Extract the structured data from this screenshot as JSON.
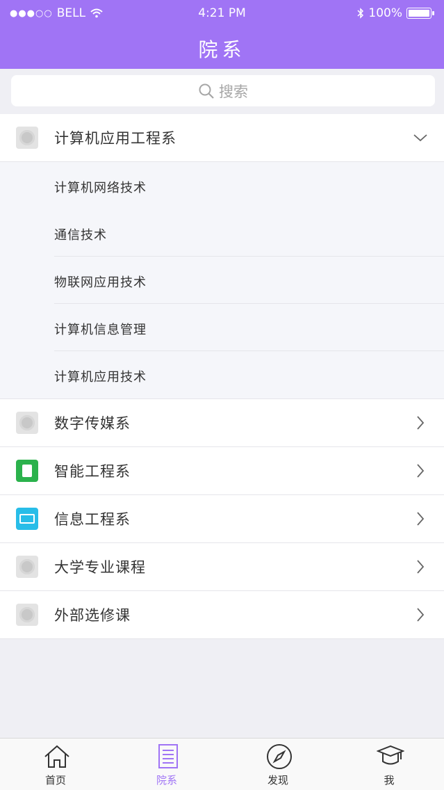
{
  "status_bar": {
    "carrier": "BELL",
    "time": "4:21 PM",
    "battery": "100%"
  },
  "nav": {
    "title": "院系"
  },
  "search": {
    "placeholder": "搜索"
  },
  "departments": [
    {
      "name": "计算机应用工程系",
      "icon": "gray-placeholder-icon",
      "expanded": true,
      "majors": [
        "计算机网络技术",
        "通信技术",
        "物联网应用技术",
        "计算机信息管理",
        "计算机应用技术"
      ]
    },
    {
      "name": "数字传媒系",
      "icon": "gray-placeholder-icon",
      "expanded": false
    },
    {
      "name": "智能工程系",
      "icon": "green-book-icon",
      "expanded": false
    },
    {
      "name": "信息工程系",
      "icon": "cyan-screen-icon",
      "expanded": false
    },
    {
      "name": "大学专业课程",
      "icon": "gray-placeholder-icon",
      "expanded": false
    },
    {
      "name": "外部选修课",
      "icon": "gray-placeholder-icon",
      "expanded": false
    }
  ],
  "tabbar": {
    "items": [
      {
        "label": "首页",
        "icon": "home-icon"
      },
      {
        "label": "院系",
        "icon": "list-icon",
        "active": true
      },
      {
        "label": "发现",
        "icon": "compass-icon"
      },
      {
        "label": "我",
        "icon": "graduation-cap-icon"
      }
    ]
  },
  "colors": {
    "accent": "#a074f5",
    "selection_bar": "#e8625f"
  }
}
